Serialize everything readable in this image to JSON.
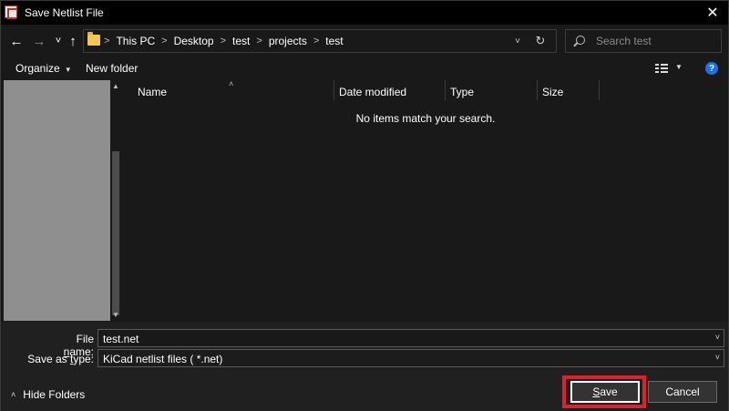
{
  "window": {
    "title": "Save Netlist File",
    "close_glyph": "✕"
  },
  "nav": {
    "back_glyph": "←",
    "forward_glyph": "→",
    "recent_glyph": "˅",
    "up_glyph": "↑",
    "breadcrumbs": [
      "This PC",
      "Desktop",
      "test",
      "projects",
      "test"
    ],
    "crumb_sep": ">",
    "address_dd_glyph": "˅",
    "refresh_glyph": "↻",
    "search_placeholder": "Search test"
  },
  "toolbar": {
    "organize_label": "Organize",
    "organize_caret": "▼",
    "new_folder_label": "New folder",
    "view_caret": "▼",
    "help_glyph": "?"
  },
  "filelist": {
    "columns": [
      "Name",
      "Date modified",
      "Type",
      "Size"
    ],
    "sort_caret": "˄",
    "empty_message": "No items match your search."
  },
  "form": {
    "file_name_label_pre": "File ",
    "file_name_label_u": "n",
    "file_name_label_post": "ame:",
    "file_name_value": "test.net",
    "save_type_label_pre": "Save as ",
    "save_type_label_u": "t",
    "save_type_label_post": "ype:",
    "save_type_value": "KiCad netlist files ( *.net)",
    "dd_glyph": "˅"
  },
  "footer": {
    "hide_folders_caret": "˄",
    "hide_folders_label": "Hide Folders",
    "save_label_u": "S",
    "save_label_post": "ave",
    "cancel_label": "Cancel"
  },
  "colors": {
    "background": "#191919",
    "titlebar": "#000000",
    "highlight": "#e0202a",
    "accent": "#1a73e8"
  },
  "icons": [
    "app-icon",
    "close-icon",
    "back-arrow-icon",
    "forward-arrow-icon",
    "recent-locations-icon",
    "up-arrow-icon",
    "folder-icon",
    "refresh-icon",
    "search-icon",
    "view-options-icon",
    "help-icon",
    "chevron-down-icon",
    "chevron-up-icon"
  ]
}
